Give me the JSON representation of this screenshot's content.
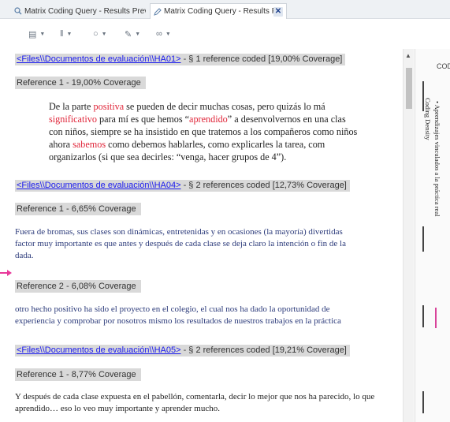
{
  "tabs": [
    {
      "label": "Matrix Coding Query - Results Prev",
      "active": false
    },
    {
      "label": "Matrix Coding Query - Results Previ",
      "active": true
    }
  ],
  "tab_close_glyph": "✕",
  "toolbar": {
    "items": [
      "comment-icon",
      "bars-icon",
      "circle-icon",
      "pen-icon",
      "link-icon"
    ],
    "glyphs": [
      "▤",
      "‖",
      "○",
      "✎",
      "∞"
    ],
    "caret": "▼"
  },
  "sources": [
    {
      "link": "<Files\\\\Documentos de evaluación\\\\HA01>",
      "suffix": " - § 1 reference coded  [19,00% Coverage]"
    },
    {
      "link": "<Files\\\\Documentos de evaluación\\\\HA04>",
      "suffix": " - § 2 references coded  [12,73% Coverage]"
    },
    {
      "link": "<Files\\\\Documentos de evaluación\\\\HA05>",
      "suffix": " - § 2 references coded  [19,21% Coverage]"
    }
  ],
  "references": [
    "Reference 1 - 19,00% Coverage",
    "Reference 1 - 6,65% Coverage",
    "Reference 2 - 6,08% Coverage",
    "Reference 1 - 8,77% Coverage"
  ],
  "ha01_text": {
    "l1a": "De la parte ",
    "l1b": "positiva",
    "l1c": " se pueden de decir muchas cosas, pero quizás lo má",
    "l2a": "significativo",
    "l2b": " para mí es que hemos “",
    "l2c": "aprendido",
    "l2d": "” a desenvolvernos en una clas",
    "l3": "con niños, siempre se ha insistido en que tratemos a los compañeros como niños",
    "l4a": "ahora ",
    "l4b": "sabemos",
    "l4c": " como debemos hablarles, como explicarles la tarea, com",
    "l5": "organizarlos (si que sea decirles: “venga, hacer grupos de 4”)."
  },
  "ha04_ref1_lines": [
    "Fuera de bromas, sus clases son dinámicas, entretenidas y en ocasiones (la mayoría) divertidas",
    "factor muy importante es que  antes y después de cada clase se deja claro la intención o fin de la",
    "dada."
  ],
  "ha04_ref2_lines": [
    "otro hecho positivo ha sido el proyecto en el colegio, el cual nos ha dado la oportunidad de",
    "experiencia y comprobar por nosotros mismo los resultados de nuestros trabajos en la práctica"
  ],
  "ha05_ref1_lines": [
    "Y después de cada clase expuesta en el pabellón, comentarla, decir lo mejor que nos ha parecido, lo que",
    "aprendido… eso lo veo muy importante y aprender mucho."
  ],
  "right_panel": {
    "header": "COD",
    "density_label": "Coding Density",
    "node_label": "• Aprendizajes vinculados a la práctica real"
  },
  "colors": {
    "highlight": "#e0263a",
    "navy_text": "#2b3a7a",
    "link": "#1a1aee",
    "reference_bg": "#d9d9d9",
    "arrow": "#e8399a",
    "stripe_pink": "#d8439a",
    "stripe_dark": "#444444"
  },
  "scroll_up_glyph": "▲"
}
